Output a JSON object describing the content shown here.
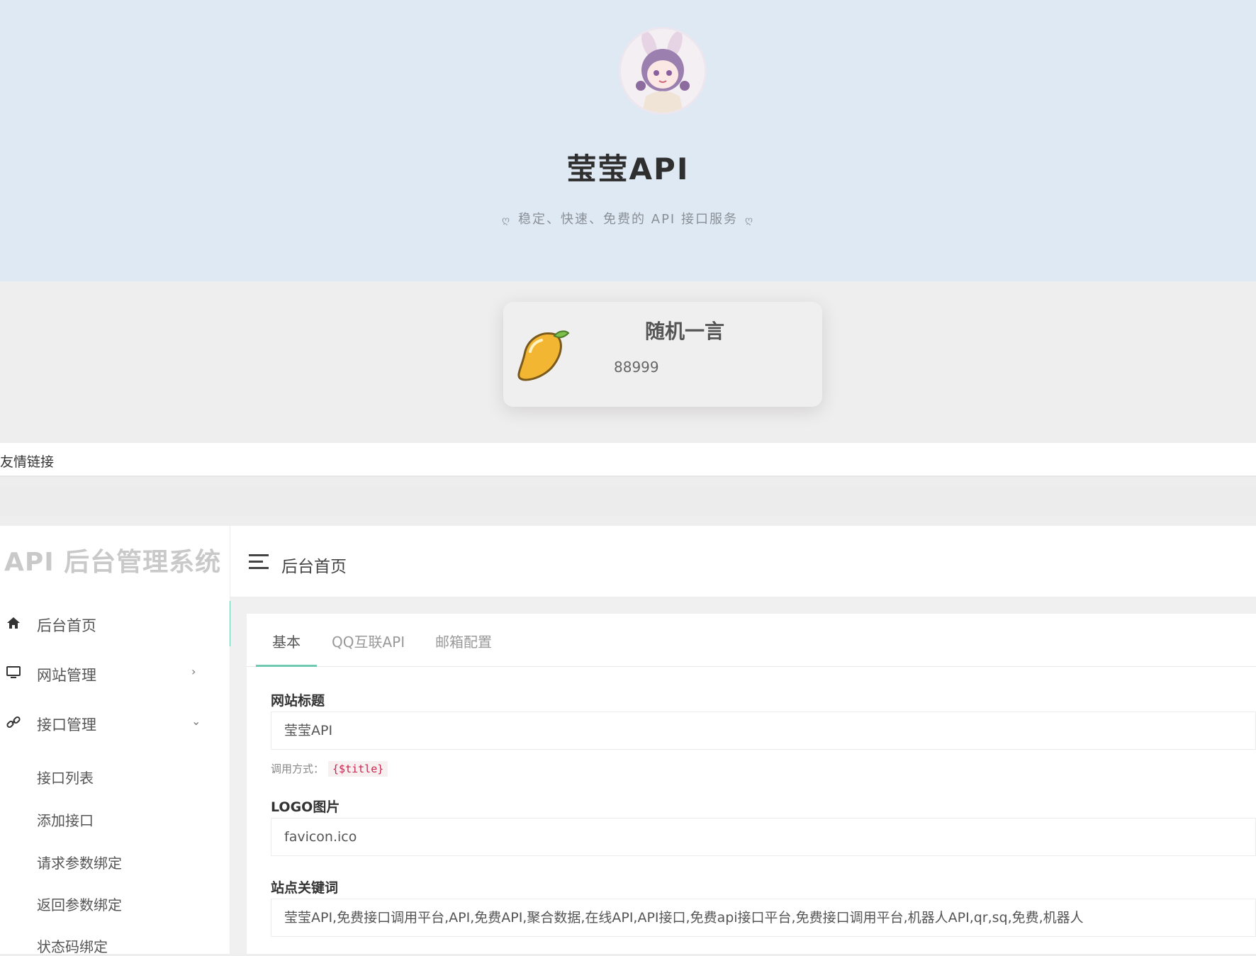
{
  "hero": {
    "title": "莹莹API",
    "tagline": "稳定、快速、免费的 API 接口服务",
    "ornament": "ღ"
  },
  "quote_card": {
    "title": "随机一言",
    "text": "88999"
  },
  "friends": {
    "label": "友情链接"
  },
  "admin": {
    "brand": "API 后台管理系统",
    "breadcrumb": "后台首页",
    "nav": [
      {
        "label": "后台首页",
        "icon": "home-icon"
      },
      {
        "label": "网站管理",
        "icon": "monitor-icon",
        "chevron": "›"
      },
      {
        "label": "接口管理",
        "icon": "link-icon",
        "chevron": "⌄"
      }
    ],
    "sub_nav": [
      "接口列表",
      "添加接口",
      "请求参数绑定",
      "返回参数绑定",
      "状态码绑定"
    ],
    "tabs": [
      "基本",
      "QQ互联API",
      "邮箱配置"
    ],
    "fields": {
      "title_label": "网站标题",
      "title_value": "莹莹API",
      "hint_label": "调用方式：",
      "hint_code": "{$title}",
      "logo_label": "LOGO图片",
      "logo_value": "favicon.ico",
      "keywords_label": "站点关键词",
      "keywords_value": "莹莹API,免费接口调用平台,API,免费API,聚合数据,在线API,API接口,免费api接口平台,免费接口调用平台,机器人API,qr,sq,免费,机器人"
    }
  },
  "colors": {
    "hero_bg": "#dfe9f4",
    "accent": "#6fc9b0",
    "page_bg": "#efeeee"
  }
}
